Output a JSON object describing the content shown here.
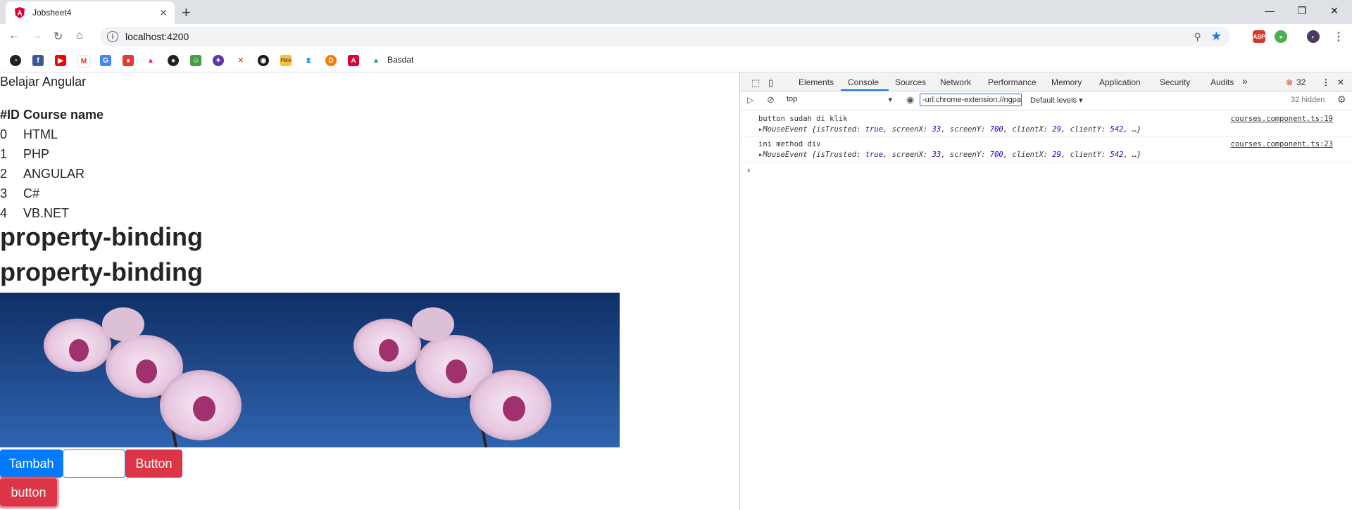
{
  "browser": {
    "tab_title": "Jobsheet4",
    "url": "localhost:4200",
    "bookmark_label": "Basdat"
  },
  "page": {
    "title": "Belajar Angular",
    "table": {
      "headers": [
        "#ID",
        "Course name"
      ],
      "rows": [
        [
          "0",
          "HTML"
        ],
        [
          "1",
          "PHP"
        ],
        [
          "2",
          "ANGULAR"
        ],
        [
          "3",
          "C#"
        ],
        [
          "4",
          "VB.NET"
        ]
      ]
    },
    "headings": [
      "property-binding",
      "property-binding"
    ],
    "buttons": {
      "tambah": "Tambah",
      "button": "Button",
      "button_lower": "button"
    },
    "input_value": ""
  },
  "devtools": {
    "tabs": [
      "Elements",
      "Console",
      "Sources",
      "Network",
      "Performance",
      "Memory",
      "Application",
      "Security",
      "Audits"
    ],
    "error_count": "32",
    "context": "top",
    "filter": "-url:chrome-extension://ngpa",
    "levels": "Default levels",
    "hidden": "32 hidden",
    "messages": [
      {
        "text": "button sudah di klik",
        "source": "courses.component.ts:19",
        "event": "MouseEvent",
        "detail_prefix": " {isTrusted: ",
        "isTrusted": "true",
        "screenX": "33",
        "screenY": "700",
        "clientX": "29",
        "clientY": "542"
      },
      {
        "text": "ini method div",
        "source": "courses.component.ts:23",
        "event": "MouseEvent",
        "detail_prefix": " {isTrusted: ",
        "isTrusted": "true",
        "screenX": "33",
        "screenY": "700",
        "clientX": "29",
        "clientY": "542"
      }
    ]
  },
  "colors": {
    "primary_button": "#007bff",
    "danger_button": "#dc3545",
    "devtools_accent": "#1a73e8"
  }
}
